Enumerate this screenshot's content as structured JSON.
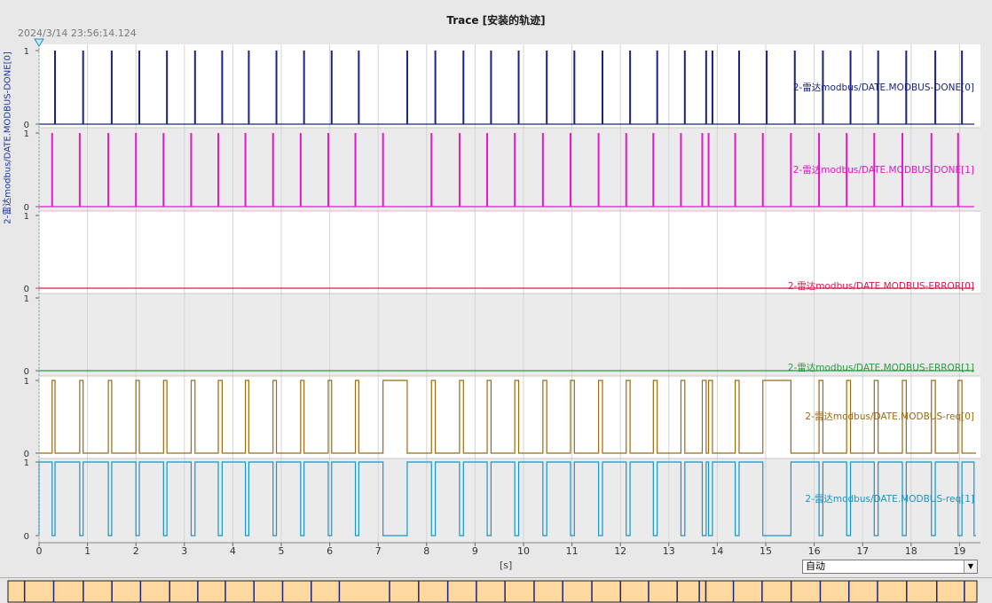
{
  "window": {
    "title": "Trace [安装的轨迹]",
    "timestamp": "2024/3/14 23:56:14.124",
    "mode": "自动"
  },
  "chart_data": {
    "type": "line",
    "xlabel": "[s]",
    "ylabel": "2-雷达modbus/DATE.MODBUS-DONE[0]",
    "xlim": [
      0,
      19.3
    ],
    "x_ticks": [
      0,
      1,
      2,
      3,
      4,
      5,
      6,
      7,
      8,
      9,
      10,
      11,
      12,
      13,
      14,
      15,
      16,
      17,
      18,
      19
    ],
    "ylim": [
      0,
      1
    ],
    "y_ticks": [
      0,
      1
    ],
    "series": [
      {
        "name": "2-雷达modbus/DATE.MODBUS-DONE[0]",
        "color": "#1a237e",
        "pulses": [
          0.33,
          0.91,
          1.5,
          2.07,
          2.64,
          3.22,
          3.78,
          4.33,
          4.9,
          5.47,
          6.04,
          6.6,
          7.6,
          8.18,
          8.76,
          9.33,
          9.9,
          10.48,
          11.05,
          11.63,
          12.2,
          12.76,
          13.33,
          13.77,
          13.9,
          14.45,
          15.02,
          15.6,
          16.18,
          16.75,
          17.32,
          17.9,
          18.5,
          19.05
        ]
      },
      {
        "name": "2-雷达modbus/DATE.MODBUS-DONE[1]",
        "color": "#e617c8",
        "pulses": [
          0.27,
          0.84,
          1.43,
          2.0,
          2.57,
          3.14,
          3.7,
          4.26,
          4.83,
          5.4,
          5.97,
          6.53,
          7.1,
          8.1,
          8.68,
          9.25,
          9.82,
          10.4,
          10.97,
          11.55,
          12.12,
          12.68,
          13.25,
          13.69,
          13.82,
          14.37,
          14.94,
          15.52,
          16.1,
          16.67,
          17.24,
          17.82,
          18.42,
          18.97
        ]
      },
      {
        "name": "2-雷达modbus/DATE.MODBUS-ERROR[0]",
        "color": "#d81b4a",
        "pulses": []
      },
      {
        "name": "2-雷达modbus/DATE.MODBUS-ERROR[1]",
        "color": "#20a040",
        "pulses": []
      },
      {
        "name": "2-雷达modbus/DATE.MODBUS-req[0]",
        "color": "#9a6a14",
        "high": [
          [
            0.27,
            0.33
          ],
          [
            0.84,
            0.91
          ],
          [
            1.43,
            1.5
          ],
          [
            2.0,
            2.07
          ],
          [
            2.57,
            2.64
          ],
          [
            3.14,
            3.22
          ],
          [
            3.7,
            3.78
          ],
          [
            4.26,
            4.33
          ],
          [
            4.83,
            4.9
          ],
          [
            5.4,
            5.47
          ],
          [
            5.97,
            6.04
          ],
          [
            6.53,
            6.6
          ],
          [
            7.1,
            7.6
          ],
          [
            8.1,
            8.18
          ],
          [
            8.68,
            8.76
          ],
          [
            9.25,
            9.33
          ],
          [
            9.82,
            9.9
          ],
          [
            10.4,
            10.48
          ],
          [
            10.97,
            11.05
          ],
          [
            11.55,
            11.63
          ],
          [
            12.12,
            12.2
          ],
          [
            12.68,
            12.76
          ],
          [
            13.25,
            13.33
          ],
          [
            13.69,
            13.77
          ],
          [
            13.82,
            13.9
          ],
          [
            14.37,
            14.45
          ],
          [
            14.94,
            15.52
          ],
          [
            16.1,
            16.18
          ],
          [
            16.67,
            16.75
          ],
          [
            17.24,
            17.32
          ],
          [
            17.82,
            17.9
          ],
          [
            18.42,
            18.5
          ],
          [
            18.97,
            19.05
          ]
        ]
      },
      {
        "name": "2-雷达modbus/DATE.MODBUS-req[1]",
        "color": "#1a94c8",
        "high": [
          [
            0.0,
            0.27
          ],
          [
            0.33,
            0.84
          ],
          [
            0.91,
            1.43
          ],
          [
            1.5,
            2.0
          ],
          [
            2.07,
            2.57
          ],
          [
            2.64,
            3.14
          ],
          [
            3.22,
            3.7
          ],
          [
            3.78,
            4.26
          ],
          [
            4.33,
            4.83
          ],
          [
            4.9,
            5.4
          ],
          [
            5.47,
            5.97
          ],
          [
            6.04,
            6.53
          ],
          [
            6.6,
            7.1
          ],
          [
            7.6,
            8.1
          ],
          [
            8.18,
            8.68
          ],
          [
            8.76,
            9.25
          ],
          [
            9.33,
            9.82
          ],
          [
            9.9,
            10.4
          ],
          [
            10.48,
            10.97
          ],
          [
            11.05,
            11.55
          ],
          [
            11.63,
            12.12
          ],
          [
            12.2,
            12.68
          ],
          [
            12.76,
            13.25
          ],
          [
            13.33,
            13.69
          ],
          [
            13.77,
            13.82
          ],
          [
            13.9,
            14.37
          ],
          [
            14.45,
            14.94
          ],
          [
            15.52,
            16.1
          ],
          [
            16.18,
            16.67
          ],
          [
            16.75,
            17.24
          ],
          [
            17.32,
            17.82
          ],
          [
            17.9,
            18.42
          ],
          [
            18.5,
            18.97
          ],
          [
            19.05,
            19.3
          ]
        ]
      }
    ]
  }
}
